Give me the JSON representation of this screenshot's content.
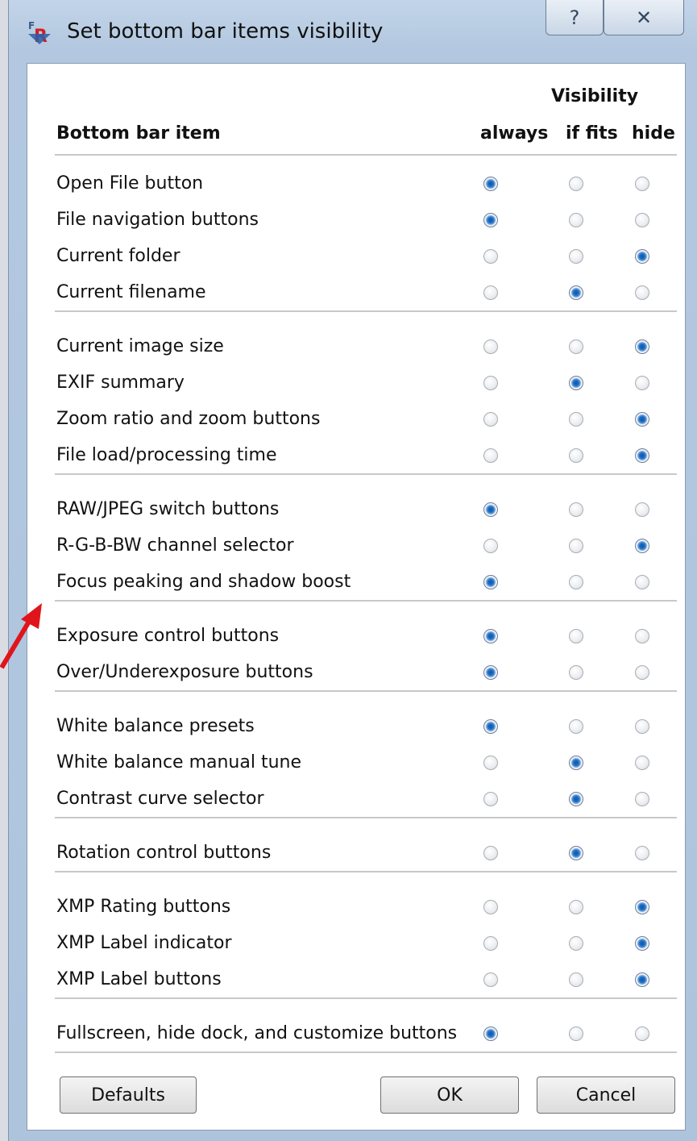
{
  "window": {
    "title": "Set bottom bar items visibility",
    "help_label": "?",
    "close_label": "✕"
  },
  "table": {
    "group_header": "Visibility",
    "item_header": "Bottom bar item",
    "columns": [
      "always",
      "if fits",
      "hide"
    ],
    "groups": [
      [
        {
          "label": "Open File button",
          "selected": "always"
        },
        {
          "label": "File navigation buttons",
          "selected": "always"
        },
        {
          "label": "Current folder",
          "selected": "hide"
        },
        {
          "label": "Current filename",
          "selected": "if fits"
        }
      ],
      [
        {
          "label": "Current image size",
          "selected": "hide"
        },
        {
          "label": "EXIF summary",
          "selected": "if fits"
        },
        {
          "label": "Zoom ratio and zoom buttons",
          "selected": "hide"
        },
        {
          "label": "File load/processing time",
          "selected": "hide"
        }
      ],
      [
        {
          "label": "RAW/JPEG switch buttons",
          "selected": "always"
        },
        {
          "label": "R-G-B-BW channel selector",
          "selected": "hide"
        },
        {
          "label": "Focus peaking and shadow boost",
          "selected": "always"
        }
      ],
      [
        {
          "label": "Exposure control buttons",
          "selected": "always"
        },
        {
          "label": "Over/Underexposure buttons",
          "selected": "always"
        }
      ],
      [
        {
          "label": "White balance presets",
          "selected": "always"
        },
        {
          "label": "White balance manual tune",
          "selected": "if fits"
        },
        {
          "label": "Contrast curve selector",
          "selected": "if fits"
        }
      ],
      [
        {
          "label": "Rotation control buttons",
          "selected": "if fits"
        }
      ],
      [
        {
          "label": "XMP Rating buttons",
          "selected": "hide"
        },
        {
          "label": "XMP Label indicator",
          "selected": "hide"
        },
        {
          "label": "XMP Label buttons",
          "selected": "hide"
        }
      ],
      [
        {
          "label": "Fullscreen, hide dock, and customize buttons",
          "selected": "always"
        }
      ]
    ]
  },
  "buttons": {
    "defaults": "Defaults",
    "ok": "OK",
    "cancel": "Cancel"
  },
  "colors": {
    "annotation_arrow": "#e0151b",
    "radio_selected": "#1e70c9"
  }
}
